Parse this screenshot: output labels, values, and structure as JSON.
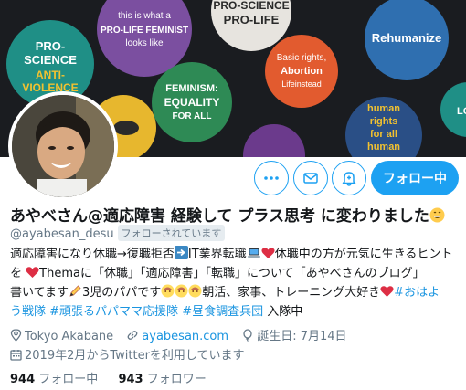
{
  "header": {
    "banner": {
      "buttons": [
        {
          "text1": "PRO-",
          "text2": "SCIENCE",
          "text3": "ANTI-",
          "text4": "VIOLENCE"
        },
        {
          "text1": "this is what a",
          "text2": "PRO-LIFE FEMINIST",
          "text3": "looks like"
        },
        {
          "text1": "PRO-SCIENCE",
          "text2": "PRO-LIFE"
        },
        {
          "text1": "Rehumanize"
        },
        {
          "text1": "Basic rights,",
          "text2": "Abortion",
          "text3": "Lifeinstead"
        },
        {
          "text1": "FEMINISM:",
          "text2": "EQUALITY",
          "text3": "FOR ALL"
        },
        {
          "text1": "human",
          "text2": "rights",
          "text3": "for all",
          "text4": "human"
        },
        {
          "text1": "LO"
        }
      ]
    }
  },
  "actions": {
    "more_icon": "more-icon",
    "message_icon": "envelope-icon",
    "notify_icon": "bell-plus-icon",
    "follow_label": "フォロー中"
  },
  "profile": {
    "name": "あやべさん@適応障害 経験して プラス思考 に変わりました",
    "handle": "@ayabesan_desu",
    "follows_you": "フォローされています",
    "bio_lines": [
      {
        "a": "適応障害になり休職→復職拒否",
        "b": "IT業界転職",
        "c": "休職中の方が元気に生きるヒント"
      },
      {
        "a": "を",
        "b": "Themaに「休職」「適応障害」「転職」について「あやべさんのブログ」"
      },
      {
        "a": "書いてます",
        "b": "3児のパパです",
        "c": "朝活、家事、トレーニング大好き",
        "d": "#おはよ"
      },
      {
        "a": "う戦隊",
        "b": "#頑張るパパママ応援隊",
        "c": "#昼食調査兵団",
        "d": "入隊中"
      }
    ],
    "location": "Tokyo Akabane",
    "website": "ayabesan.com",
    "birthday": "誕生日: 7月14日",
    "joined": "2019年2月からTwitterを利用しています",
    "following_count": "944",
    "following_label": "フォロー中",
    "followers_count": "943",
    "followers_label": "フォロワー"
  },
  "colors": {
    "accent": "#1da1f2",
    "link": "#1b95e0",
    "muted": "#657786",
    "heart": "#e0245e"
  }
}
